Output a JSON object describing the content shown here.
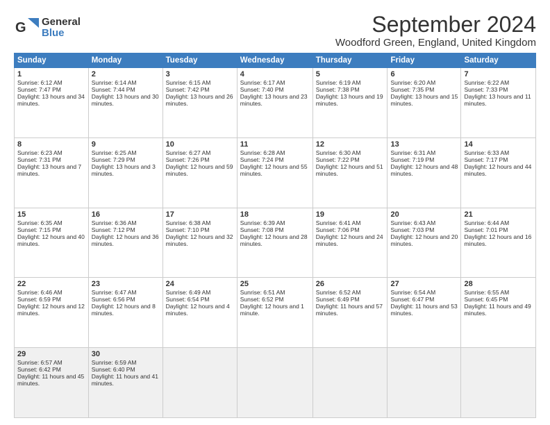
{
  "header": {
    "logo_line1": "General",
    "logo_line2": "Blue",
    "month": "September 2024",
    "location": "Woodford Green, England, United Kingdom"
  },
  "days_of_week": [
    "Sunday",
    "Monday",
    "Tuesday",
    "Wednesday",
    "Thursday",
    "Friday",
    "Saturday"
  ],
  "weeks": [
    [
      {
        "day": "1",
        "sunrise": "Sunrise: 6:12 AM",
        "sunset": "Sunset: 7:47 PM",
        "daylight": "Daylight: 13 hours and 34 minutes."
      },
      {
        "day": "2",
        "sunrise": "Sunrise: 6:14 AM",
        "sunset": "Sunset: 7:44 PM",
        "daylight": "Daylight: 13 hours and 30 minutes."
      },
      {
        "day": "3",
        "sunrise": "Sunrise: 6:15 AM",
        "sunset": "Sunset: 7:42 PM",
        "daylight": "Daylight: 13 hours and 26 minutes."
      },
      {
        "day": "4",
        "sunrise": "Sunrise: 6:17 AM",
        "sunset": "Sunset: 7:40 PM",
        "daylight": "Daylight: 13 hours and 23 minutes."
      },
      {
        "day": "5",
        "sunrise": "Sunrise: 6:19 AM",
        "sunset": "Sunset: 7:38 PM",
        "daylight": "Daylight: 13 hours and 19 minutes."
      },
      {
        "day": "6",
        "sunrise": "Sunrise: 6:20 AM",
        "sunset": "Sunset: 7:35 PM",
        "daylight": "Daylight: 13 hours and 15 minutes."
      },
      {
        "day": "7",
        "sunrise": "Sunrise: 6:22 AM",
        "sunset": "Sunset: 7:33 PM",
        "daylight": "Daylight: 13 hours and 11 minutes."
      }
    ],
    [
      {
        "day": "8",
        "sunrise": "Sunrise: 6:23 AM",
        "sunset": "Sunset: 7:31 PM",
        "daylight": "Daylight: 13 hours and 7 minutes."
      },
      {
        "day": "9",
        "sunrise": "Sunrise: 6:25 AM",
        "sunset": "Sunset: 7:29 PM",
        "daylight": "Daylight: 13 hours and 3 minutes."
      },
      {
        "day": "10",
        "sunrise": "Sunrise: 6:27 AM",
        "sunset": "Sunset: 7:26 PM",
        "daylight": "Daylight: 12 hours and 59 minutes."
      },
      {
        "day": "11",
        "sunrise": "Sunrise: 6:28 AM",
        "sunset": "Sunset: 7:24 PM",
        "daylight": "Daylight: 12 hours and 55 minutes."
      },
      {
        "day": "12",
        "sunrise": "Sunrise: 6:30 AM",
        "sunset": "Sunset: 7:22 PM",
        "daylight": "Daylight: 12 hours and 51 minutes."
      },
      {
        "day": "13",
        "sunrise": "Sunrise: 6:31 AM",
        "sunset": "Sunset: 7:19 PM",
        "daylight": "Daylight: 12 hours and 48 minutes."
      },
      {
        "day": "14",
        "sunrise": "Sunrise: 6:33 AM",
        "sunset": "Sunset: 7:17 PM",
        "daylight": "Daylight: 12 hours and 44 minutes."
      }
    ],
    [
      {
        "day": "15",
        "sunrise": "Sunrise: 6:35 AM",
        "sunset": "Sunset: 7:15 PM",
        "daylight": "Daylight: 12 hours and 40 minutes."
      },
      {
        "day": "16",
        "sunrise": "Sunrise: 6:36 AM",
        "sunset": "Sunset: 7:12 PM",
        "daylight": "Daylight: 12 hours and 36 minutes."
      },
      {
        "day": "17",
        "sunrise": "Sunrise: 6:38 AM",
        "sunset": "Sunset: 7:10 PM",
        "daylight": "Daylight: 12 hours and 32 minutes."
      },
      {
        "day": "18",
        "sunrise": "Sunrise: 6:39 AM",
        "sunset": "Sunset: 7:08 PM",
        "daylight": "Daylight: 12 hours and 28 minutes."
      },
      {
        "day": "19",
        "sunrise": "Sunrise: 6:41 AM",
        "sunset": "Sunset: 7:06 PM",
        "daylight": "Daylight: 12 hours and 24 minutes."
      },
      {
        "day": "20",
        "sunrise": "Sunrise: 6:43 AM",
        "sunset": "Sunset: 7:03 PM",
        "daylight": "Daylight: 12 hours and 20 minutes."
      },
      {
        "day": "21",
        "sunrise": "Sunrise: 6:44 AM",
        "sunset": "Sunset: 7:01 PM",
        "daylight": "Daylight: 12 hours and 16 minutes."
      }
    ],
    [
      {
        "day": "22",
        "sunrise": "Sunrise: 6:46 AM",
        "sunset": "Sunset: 6:59 PM",
        "daylight": "Daylight: 12 hours and 12 minutes."
      },
      {
        "day": "23",
        "sunrise": "Sunrise: 6:47 AM",
        "sunset": "Sunset: 6:56 PM",
        "daylight": "Daylight: 12 hours and 8 minutes."
      },
      {
        "day": "24",
        "sunrise": "Sunrise: 6:49 AM",
        "sunset": "Sunset: 6:54 PM",
        "daylight": "Daylight: 12 hours and 4 minutes."
      },
      {
        "day": "25",
        "sunrise": "Sunrise: 6:51 AM",
        "sunset": "Sunset: 6:52 PM",
        "daylight": "Daylight: 12 hours and 1 minute."
      },
      {
        "day": "26",
        "sunrise": "Sunrise: 6:52 AM",
        "sunset": "Sunset: 6:49 PM",
        "daylight": "Daylight: 11 hours and 57 minutes."
      },
      {
        "day": "27",
        "sunrise": "Sunrise: 6:54 AM",
        "sunset": "Sunset: 6:47 PM",
        "daylight": "Daylight: 11 hours and 53 minutes."
      },
      {
        "day": "28",
        "sunrise": "Sunrise: 6:55 AM",
        "sunset": "Sunset: 6:45 PM",
        "daylight": "Daylight: 11 hours and 49 minutes."
      }
    ],
    [
      {
        "day": "29",
        "sunrise": "Sunrise: 6:57 AM",
        "sunset": "Sunset: 6:42 PM",
        "daylight": "Daylight: 11 hours and 45 minutes."
      },
      {
        "day": "30",
        "sunrise": "Sunrise: 6:59 AM",
        "sunset": "Sunset: 6:40 PM",
        "daylight": "Daylight: 11 hours and 41 minutes."
      },
      null,
      null,
      null,
      null,
      null
    ]
  ]
}
